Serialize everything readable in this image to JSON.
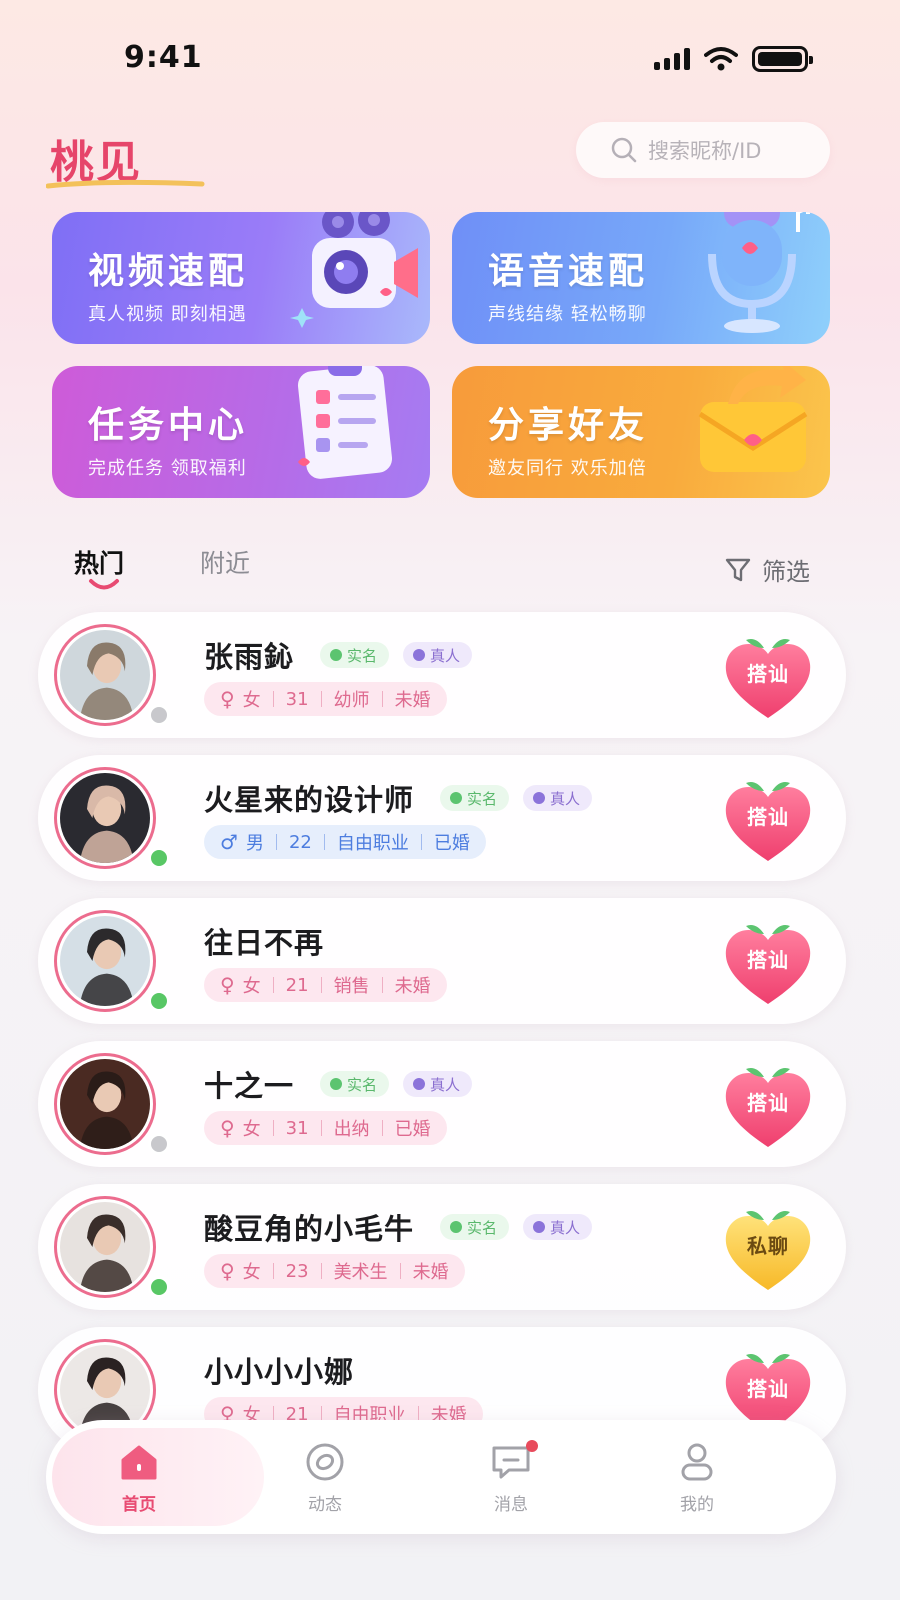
{
  "status_bar": {
    "time": "9:41"
  },
  "header": {
    "logo": "桃见",
    "search_placeholder": "搜索昵称/ID"
  },
  "feature_cards": [
    {
      "title": "视频速配",
      "subtitle": "真人视频 即刻相遇",
      "icon": "video-camera-icon"
    },
    {
      "title": "语音速配",
      "subtitle": "声线结缘 轻松畅聊",
      "icon": "microphone-icon"
    },
    {
      "title": "任务中心",
      "subtitle": "完成任务 领取福利",
      "icon": "clipboard-checklist-icon"
    },
    {
      "title": "分享好友",
      "subtitle": "邀友同行 欢乐加倍",
      "icon": "share-envelope-icon"
    }
  ],
  "tabs": [
    {
      "label": "热门",
      "active": true
    },
    {
      "label": "附近",
      "active": false
    }
  ],
  "filter_label": "筛选",
  "badge_labels": {
    "verified": "实名",
    "real": "真人"
  },
  "users": [
    {
      "name": "张雨鈊",
      "gender": "女",
      "age": "31",
      "job": "幼师",
      "marital": "未婚",
      "verified": true,
      "real": true,
      "online": false,
      "action": "搭讪"
    },
    {
      "name": "火星来的设计师",
      "gender": "男",
      "age": "22",
      "job": "自由职业",
      "marital": "已婚",
      "verified": true,
      "real": true,
      "online": true,
      "action": "搭讪"
    },
    {
      "name": "往日不再",
      "gender": "女",
      "age": "21",
      "job": "销售",
      "marital": "未婚",
      "verified": false,
      "real": false,
      "online": true,
      "action": "搭讪"
    },
    {
      "name": "十之一",
      "gender": "女",
      "age": "31",
      "job": "出纳",
      "marital": "已婚",
      "verified": true,
      "real": true,
      "online": false,
      "action": "搭讪"
    },
    {
      "name": "酸豆角的小毛牛",
      "gender": "女",
      "age": "23",
      "job": "美术生",
      "marital": "未婚",
      "verified": true,
      "real": true,
      "online": true,
      "action": "私聊"
    },
    {
      "name": "小小小小娜",
      "gender": "女",
      "age": "21",
      "job": "自由职业",
      "marital": "未婚",
      "verified": false,
      "real": false,
      "online": false,
      "action": "搭讪"
    }
  ],
  "bottom_nav": [
    {
      "label": "首页",
      "icon": "home-icon",
      "active": true
    },
    {
      "label": "动态",
      "icon": "moments-icon",
      "active": false
    },
    {
      "label": "消息",
      "icon": "message-icon",
      "active": false
    },
    {
      "label": "我的",
      "icon": "profile-icon",
      "active": false
    }
  ],
  "colors": {
    "brand_pink": "#e84b72",
    "online_green": "#58c765",
    "verified_green": "#5ab86c",
    "real_purple": "#8b6fd0"
  }
}
